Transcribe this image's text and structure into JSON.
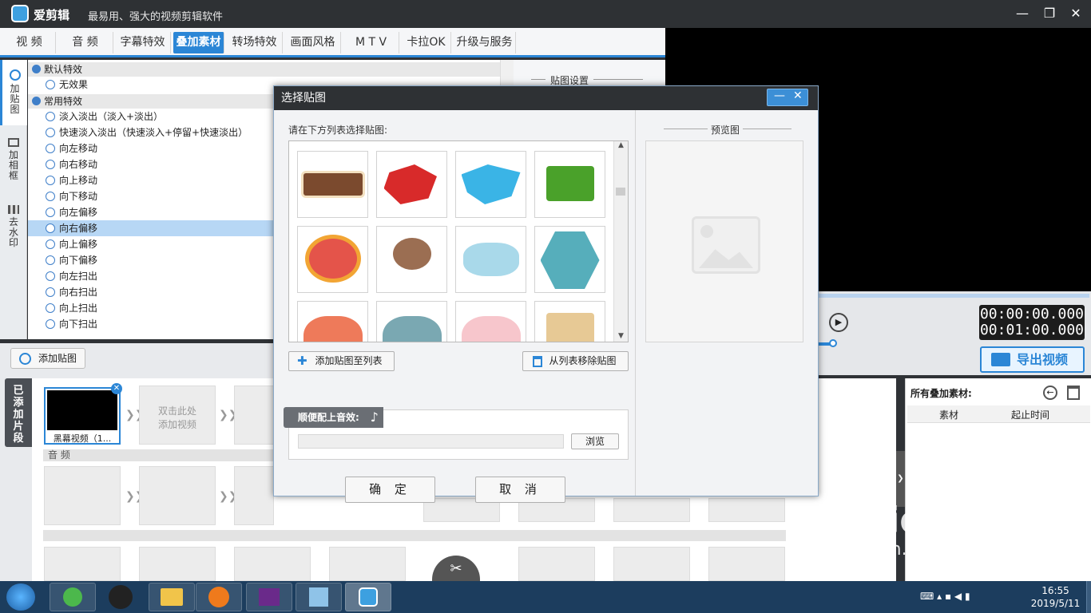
{
  "app": {
    "name": "爱剪辑",
    "slogan": "最易用、强大的视频剪辑软件"
  },
  "window_controls": {
    "minimize": "—",
    "maximize": "❐",
    "close": "✕"
  },
  "tabs": [
    {
      "label": "视 频"
    },
    {
      "label": "音 频"
    },
    {
      "label": "字幕特效"
    },
    {
      "label": "叠加素材",
      "active": true
    },
    {
      "label": "转场特效"
    },
    {
      "label": "画面风格"
    },
    {
      "label": "M T V"
    },
    {
      "label": "卡拉OK"
    },
    {
      "label": "升级与服务"
    }
  ],
  "side_tabs": [
    {
      "label": "加贴图",
      "icon": "smile-sticker-icon",
      "active": true
    },
    {
      "label": "加相框",
      "icon": "frame-add-icon"
    },
    {
      "label": "去水印",
      "icon": "watermark-icon"
    }
  ],
  "effects": {
    "default_group": "默认特效",
    "no_effect": "无效果",
    "common_group": "常用特效",
    "items": [
      "淡入淡出（淡入+淡出）",
      "快速淡入淡出（快速淡入+停留+快速淡出）",
      "向左移动",
      "向右移动",
      "向上移动",
      "向下移动",
      "向左偏移",
      "向右偏移",
      "向上偏移",
      "向下偏移",
      "向左扫出",
      "向右扫出",
      "向上扫出",
      "向下扫出"
    ],
    "selected": "向右偏移"
  },
  "settings": {
    "title": "贴图设置"
  },
  "preview": {
    "time_current": "00:00:00.000",
    "time_total": "00:01:00.000"
  },
  "export": {
    "label": "导出视频"
  },
  "bottom": {
    "add_sticker_label": "添加贴图",
    "added_clips_tab": "已添加片段",
    "clip_name": "黑幕视频（1...",
    "add_video_hint": "双击此处\n添加视频",
    "audio_label": "音 频"
  },
  "overlay_list": {
    "title": "所有叠加素材:",
    "col_material": "素材",
    "col_time": "起止时间"
  },
  "dialog": {
    "title": "选择贴图",
    "prompt": "请在下方列表选择贴图:",
    "preview_label": "预览图",
    "add_to_list": "添加贴图至列表",
    "remove_from_list": "从列表移除贴图",
    "sound_label": "顺便配上音效:",
    "browse": "浏览",
    "ok": "确 定",
    "cancel": "取 消"
  },
  "taskbar": {
    "time": "16:55",
    "date": "2019/5/11"
  },
  "watermark": {
    "brand": "Baidu经验",
    "url": "jingyan.baidu.com"
  },
  "colors": {
    "accent": "#2b86d6",
    "titlebar": "#2e3134",
    "selection": "#b7d7f5"
  }
}
